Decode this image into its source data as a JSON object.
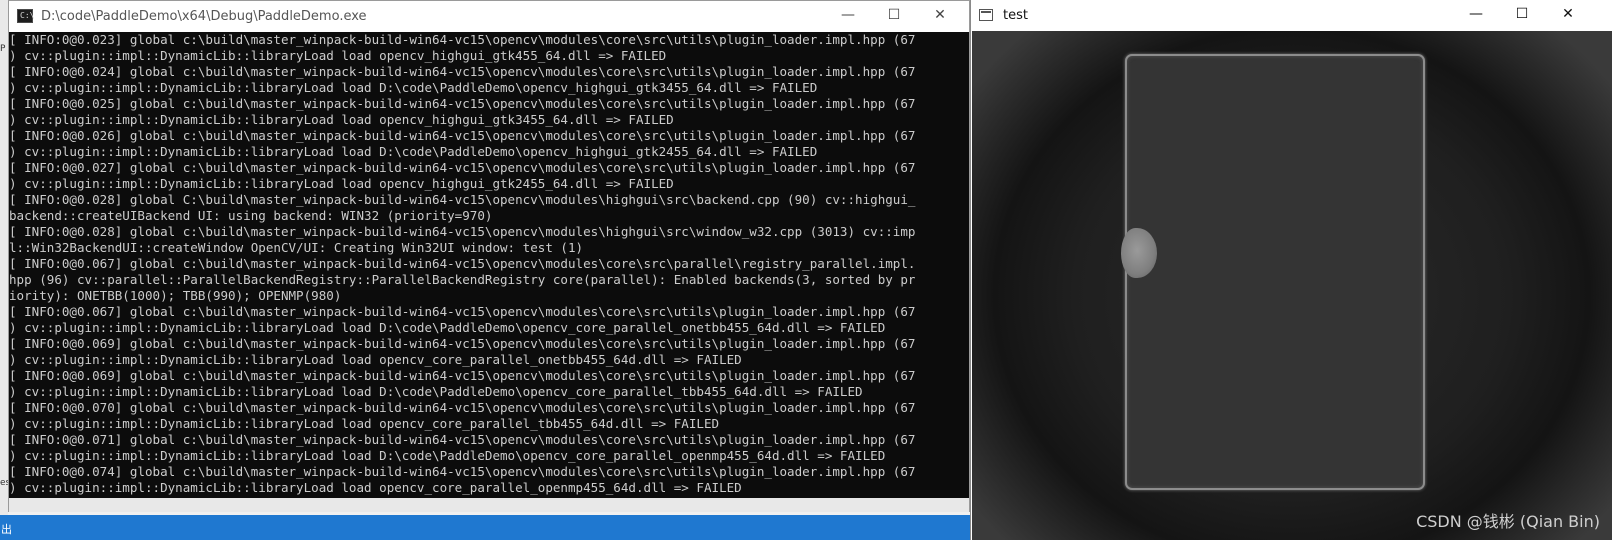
{
  "background": {
    "left_marks": [
      "P",
      "es"
    ],
    "taskbar_label": "出"
  },
  "console": {
    "title": "D:\\code\\PaddleDemo\\x64\\Debug\\PaddleDemo.exe",
    "icon_text": "C:\\",
    "minimize": "—",
    "maximize": "☐",
    "close": "✕",
    "lines": [
      "[ INFO:0@0.023] global c:\\build\\master_winpack-build-win64-vc15\\opencv\\modules\\core\\src\\utils\\plugin_loader.impl.hpp (67",
      ") cv::plugin::impl::DynamicLib::libraryLoad load opencv_highgui_gtk455_64.dll => FAILED",
      "[ INFO:0@0.024] global c:\\build\\master_winpack-build-win64-vc15\\opencv\\modules\\core\\src\\utils\\plugin_loader.impl.hpp (67",
      ") cv::plugin::impl::DynamicLib::libraryLoad load D:\\code\\PaddleDemo\\opencv_highgui_gtk3455_64.dll => FAILED",
      "[ INFO:0@0.025] global c:\\build\\master_winpack-build-win64-vc15\\opencv\\modules\\core\\src\\utils\\plugin_loader.impl.hpp (67",
      ") cv::plugin::impl::DynamicLib::libraryLoad load opencv_highgui_gtk3455_64.dll => FAILED",
      "[ INFO:0@0.026] global c:\\build\\master_winpack-build-win64-vc15\\opencv\\modules\\core\\src\\utils\\plugin_loader.impl.hpp (67",
      ") cv::plugin::impl::DynamicLib::libraryLoad load D:\\code\\PaddleDemo\\opencv_highgui_gtk2455_64.dll => FAILED",
      "[ INFO:0@0.027] global c:\\build\\master_winpack-build-win64-vc15\\opencv\\modules\\core\\src\\utils\\plugin_loader.impl.hpp (67",
      ") cv::plugin::impl::DynamicLib::libraryLoad load opencv_highgui_gtk2455_64.dll => FAILED",
      "[ INFO:0@0.028] global C:\\build\\master_winpack-build-win64-vc15\\opencv\\modules\\highgui\\src\\backend.cpp (90) cv::highgui_",
      "backend::createUIBackend UI: using backend: WIN32 (priority=970)",
      "[ INFO:0@0.028] global c:\\build\\master_winpack-build-win64-vc15\\opencv\\modules\\highgui\\src\\window_w32.cpp (3013) cv::imp",
      "l::Win32BackendUI::createWindow OpenCV/UI: Creating Win32UI window: test (1)",
      "[ INFO:0@0.067] global c:\\build\\master_winpack-build-win64-vc15\\opencv\\modules\\core\\src\\parallel\\registry_parallel.impl.",
      "hpp (96) cv::parallel::ParallelBackendRegistry::ParallelBackendRegistry core(parallel): Enabled backends(3, sorted by pr",
      "iority): ONETBB(1000); TBB(990); OPENMP(980)",
      "[ INFO:0@0.067] global c:\\build\\master_winpack-build-win64-vc15\\opencv\\modules\\core\\src\\utils\\plugin_loader.impl.hpp (67",
      ") cv::plugin::impl::DynamicLib::libraryLoad load D:\\code\\PaddleDemo\\opencv_core_parallel_onetbb455_64d.dll => FAILED",
      "[ INFO:0@0.069] global c:\\build\\master_winpack-build-win64-vc15\\opencv\\modules\\core\\src\\utils\\plugin_loader.impl.hpp (67",
      ") cv::plugin::impl::DynamicLib::libraryLoad load opencv_core_parallel_onetbb455_64d.dll => FAILED",
      "[ INFO:0@0.069] global c:\\build\\master_winpack-build-win64-vc15\\opencv\\modules\\core\\src\\utils\\plugin_loader.impl.hpp (67",
      ") cv::plugin::impl::DynamicLib::libraryLoad load D:\\code\\PaddleDemo\\opencv_core_parallel_tbb455_64d.dll => FAILED",
      "[ INFO:0@0.070] global c:\\build\\master_winpack-build-win64-vc15\\opencv\\modules\\core\\src\\utils\\plugin_loader.impl.hpp (67",
      ") cv::plugin::impl::DynamicLib::libraryLoad load opencv_core_parallel_tbb455_64d.dll => FAILED",
      "[ INFO:0@0.071] global c:\\build\\master_winpack-build-win64-vc15\\opencv\\modules\\core\\src\\utils\\plugin_loader.impl.hpp (67",
      ") cv::plugin::impl::DynamicLib::libraryLoad load D:\\code\\PaddleDemo\\opencv_core_parallel_openmp455_64d.dll => FAILED",
      "[ INFO:0@0.074] global c:\\build\\master_winpack-build-win64-vc15\\opencv\\modules\\core\\src\\utils\\plugin_loader.impl.hpp (67",
      ") cv::plugin::impl::DynamicLib::libraryLoad load opencv_core_parallel_openmp455_64d.dll => FAILED"
    ]
  },
  "image_window": {
    "title": "test",
    "minimize": "—",
    "maximize": "☐",
    "close": "✕",
    "watermark": "CSDN @钱彬 (Qian Bin)"
  }
}
